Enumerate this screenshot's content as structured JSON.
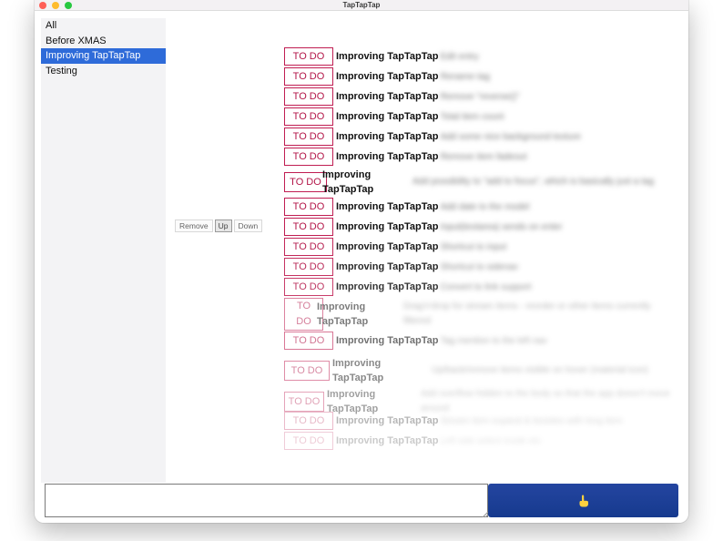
{
  "window": {
    "title": "TapTapTap"
  },
  "sidebar": {
    "items": [
      {
        "label": "All"
      },
      {
        "label": "Before XMAS"
      },
      {
        "label": "Improving TapTapTap",
        "selected": true
      },
      {
        "label": "Testing"
      }
    ]
  },
  "controls": {
    "remove_label": "Remove",
    "up_label": "Up",
    "down_label": "Down"
  },
  "tasks": {
    "items": [
      {
        "status": "TO DO",
        "tag": "Improving TapTapTap",
        "text": "Edit entry",
        "opacity": 1.0
      },
      {
        "status": "TO DO",
        "tag": "Improving TapTapTap",
        "text": "Rename tag",
        "opacity": 1.0
      },
      {
        "status": "TO DO",
        "tag": "Improving TapTapTap",
        "text": "Remove \"reverse()\"",
        "opacity": 1.0
      },
      {
        "status": "TO DO",
        "tag": "Improving TapTapTap",
        "text": "Total item count",
        "opacity": 1.0
      },
      {
        "status": "TO DO",
        "tag": "Improving TapTapTap",
        "text": "Add some nice background texture",
        "opacity": 1.0
      },
      {
        "status": "TO DO",
        "tag": "Improving TapTapTap",
        "text": "Remove item fadeout",
        "opacity": 1.0
      },
      {
        "status": "TO DO",
        "tag": "Improving TapTapTap",
        "text": "Add possibility to \"add to focus\", which is basically just a tag",
        "opacity": 1.0
      },
      {
        "status": "TO DO",
        "tag": "Improving TapTapTap",
        "text": "Add date to the model",
        "opacity": 1.0
      },
      {
        "status": "TO DO",
        "tag": "Improving TapTapTap",
        "text": "Input(textarea) sends on enter",
        "opacity": 1.0
      },
      {
        "status": "TO DO",
        "tag": "Improving TapTapTap",
        "text": "Shortcut to input",
        "opacity": 0.95
      },
      {
        "status": "TO DO",
        "tag": "Improving TapTapTap",
        "text": "Shortcut to sidenav",
        "opacity": 0.9
      },
      {
        "status": "TO DO",
        "tag": "Improving TapTapTap",
        "text": "Convert to link support",
        "opacity": 0.85
      },
      {
        "status": "TO DO",
        "tag": "Improving TapTapTap",
        "text": "Drag'n'drop for stream items - reorder or other items currently filtered",
        "opacity": 0.55
      },
      {
        "status": "TO DO",
        "tag": "Improving TapTapTap",
        "text": "Tag mention to the left nav",
        "opacity": 0.6
      },
      {
        "status": "TO DO",
        "tag": "Improving TapTapTap",
        "text": "Up/back/remove items visible on hover (material icon)",
        "opacity": 0.5
      },
      {
        "status": "TO DO",
        "tag": "Improving TapTapTap",
        "text": "Add overflow hidden to the body so that the app doesn't move around",
        "opacity": 0.4
      },
      {
        "status": "TO DO",
        "tag": "Improving TapTapTap",
        "text": "Stream item expand & besides with long item",
        "opacity": 0.3
      },
      {
        "status": "TO DO",
        "tag": "Improving TapTapTap",
        "text": "Left side select mode etc",
        "opacity": 0.22
      }
    ]
  },
  "composer": {
    "input_value": "",
    "submit_icon": "pointing-hand-icon"
  },
  "colors": {
    "accent": "#2e6bd9",
    "todo": "#c01d52",
    "submit": "#1a3c93"
  }
}
